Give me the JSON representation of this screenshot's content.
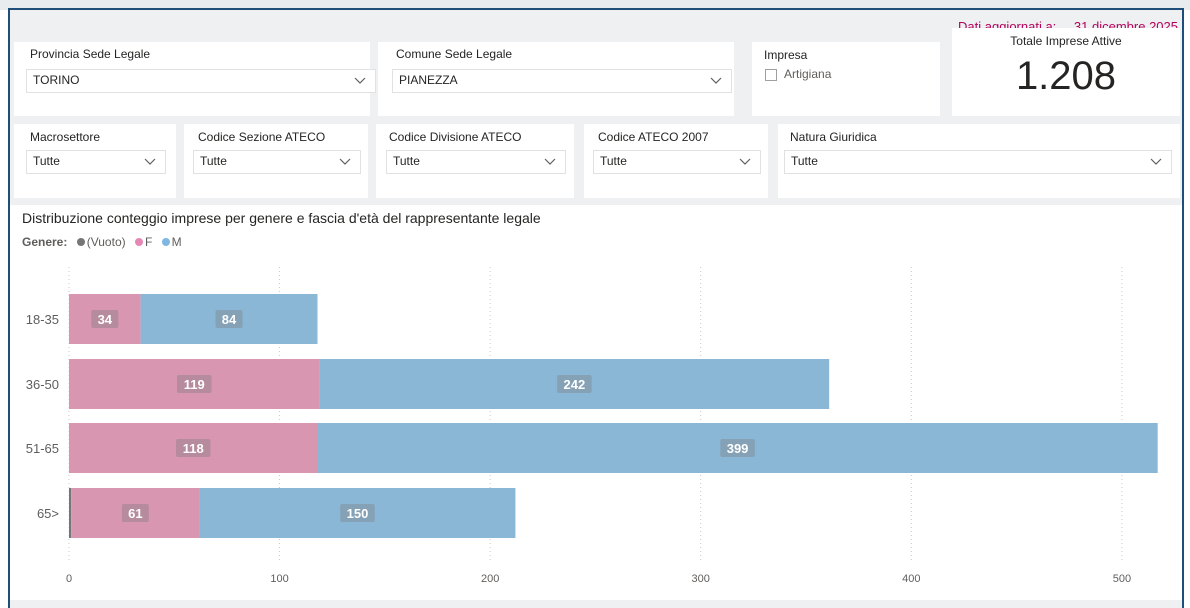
{
  "header": {
    "updated_label": "Dati aggiornati a:",
    "updated_date": "31 dicembre 2025"
  },
  "filters": {
    "provincia": {
      "label": "Provincia Sede Legale",
      "value": "TORINO"
    },
    "comune": {
      "label": "Comune Sede Legale",
      "value": "PIANEZZA"
    },
    "impresa": {
      "label": "Impresa",
      "option": "Artigiana",
      "checked": false
    },
    "macrosettore": {
      "label": "Macrosettore",
      "value": "Tutte"
    },
    "sezione_ateco": {
      "label": "Codice Sezione ATECO",
      "value": "Tutte"
    },
    "divisione_ateco": {
      "label": "Codice Divisione ATECO",
      "value": "Tutte"
    },
    "codice_ateco": {
      "label": "Codice ATECO 2007",
      "value": "Tutte"
    },
    "natura_giuridica": {
      "label": "Natura Giuridica",
      "value": "Tutte"
    }
  },
  "kpi": {
    "label": "Totale Imprese Attive",
    "value": "1.208"
  },
  "chart": {
    "title": "Distribuzione conteggio imprese per genere e fascia d'età del rappresentante legale",
    "legend_title": "Genere:",
    "legend": [
      {
        "label": "(Vuoto)",
        "color": "#767676"
      },
      {
        "label": "F",
        "color": "#e688b4"
      },
      {
        "label": "M",
        "color": "#7fb7e0"
      }
    ]
  },
  "chart_data": {
    "type": "bar",
    "orientation": "horizontal",
    "stacked": true,
    "categories": [
      "18-35",
      "36-50",
      "51-65",
      "65>"
    ],
    "series": [
      {
        "name": "(Vuoto)",
        "color": "#767676",
        "values": [
          0,
          0,
          0,
          1
        ]
      },
      {
        "name": "F",
        "color": "#d896b1",
        "values": [
          34,
          119,
          118,
          61
        ]
      },
      {
        "name": "M",
        "color": "#8ab7d6",
        "values": [
          84,
          242,
          399,
          150
        ]
      }
    ],
    "xlim": [
      0,
      520
    ],
    "xticks": [
      0,
      100,
      200,
      300,
      400,
      500
    ],
    "grid": true,
    "legend_position": "top-left"
  }
}
